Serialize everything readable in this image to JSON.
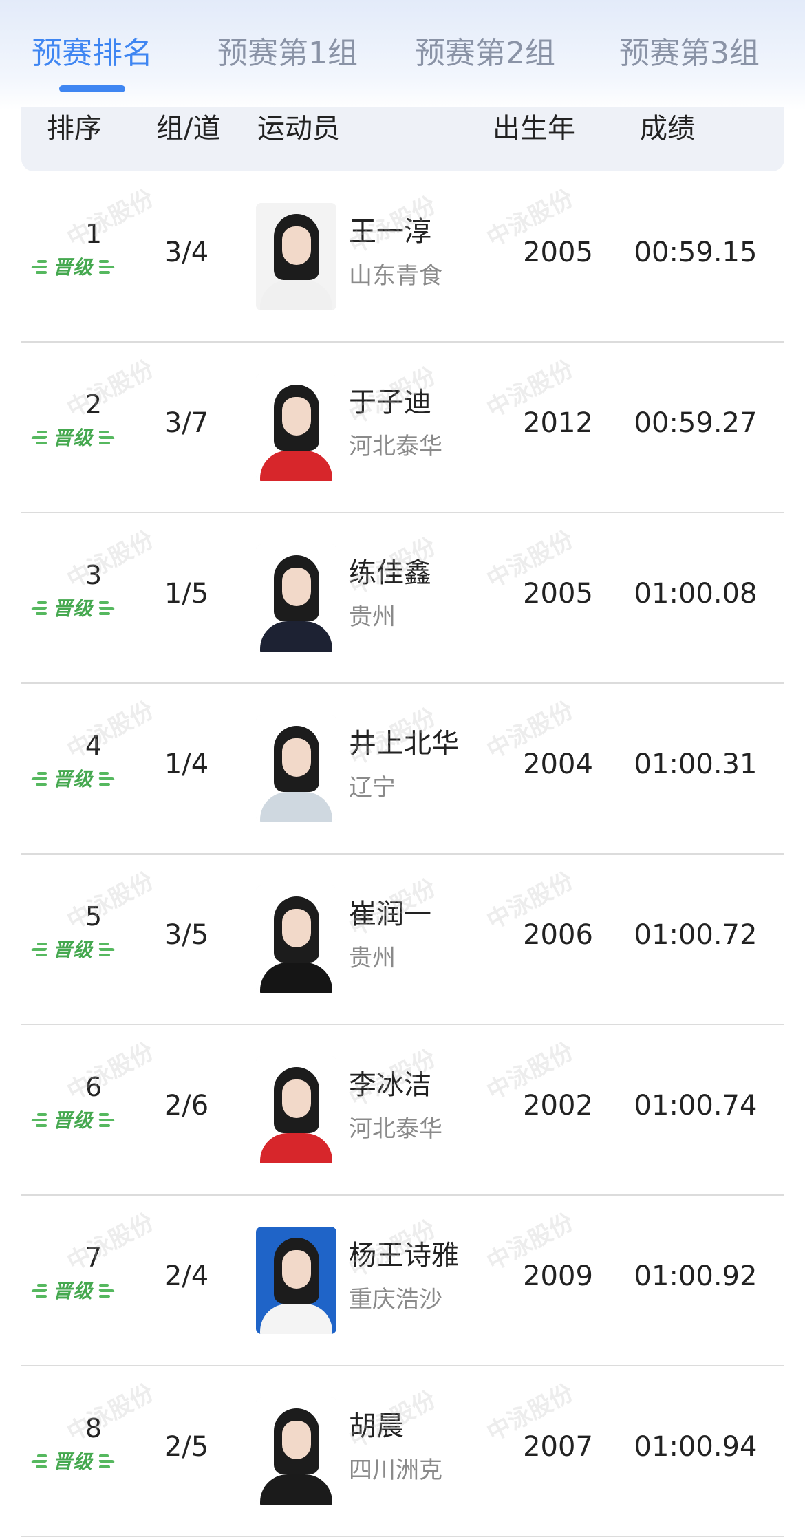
{
  "tabs": [
    {
      "label": "预赛排名",
      "active": true
    },
    {
      "label": "预赛第1组",
      "active": false
    },
    {
      "label": "预赛第2组",
      "active": false
    },
    {
      "label": "预赛第3组",
      "active": false
    }
  ],
  "table": {
    "headers": {
      "rank": "排序",
      "group_lane": "组/道",
      "athlete": "运动员",
      "birth_year": "出生年",
      "result": "成绩"
    },
    "badge_text": "晋级",
    "watermark_text": "中泳股份",
    "rows": [
      {
        "rank": "1",
        "group_lane": "3/4",
        "name": "王一淳",
        "team": "山东青食",
        "birth_year": "2005",
        "result": "00:59.15",
        "photo_bg": "#f3f3f3",
        "jersey": "#f0f0f0"
      },
      {
        "rank": "2",
        "group_lane": "3/7",
        "name": "于子迪",
        "team": "河北泰华",
        "birth_year": "2012",
        "result": "00:59.27",
        "photo_bg": "#ffffff",
        "jersey": "#d7262b"
      },
      {
        "rank": "3",
        "group_lane": "1/5",
        "name": "练佳鑫",
        "team": "贵州",
        "birth_year": "2005",
        "result": "01:00.08",
        "photo_bg": "#ffffff",
        "jersey": "#1d2233"
      },
      {
        "rank": "4",
        "group_lane": "1/4",
        "name": "井上北华",
        "team": "辽宁",
        "birth_year": "2004",
        "result": "01:00.31",
        "photo_bg": "#ffffff",
        "jersey": "#cfd8e0"
      },
      {
        "rank": "5",
        "group_lane": "3/5",
        "name": "崔润一",
        "team": "贵州",
        "birth_year": "2006",
        "result": "01:00.72",
        "photo_bg": "#ffffff",
        "jersey": "#151515"
      },
      {
        "rank": "6",
        "group_lane": "2/6",
        "name": "李冰洁",
        "team": "河北泰华",
        "birth_year": "2002",
        "result": "01:00.74",
        "photo_bg": "#ffffff",
        "jersey": "#d7262b"
      },
      {
        "rank": "7",
        "group_lane": "2/4",
        "name": "杨王诗雅",
        "team": "重庆浩沙",
        "birth_year": "2009",
        "result": "01:00.92",
        "photo_bg": "#1f64c8",
        "jersey": "#f4f4f4"
      },
      {
        "rank": "8",
        "group_lane": "2/5",
        "name": "胡晨",
        "team": "四川洲克",
        "birth_year": "2007",
        "result": "01:00.94",
        "photo_bg": "#ffffff",
        "jersey": "#1b1b1b"
      }
    ]
  },
  "colors": {
    "accent": "#3f86f2",
    "qualify_green": "#45a84f",
    "header_bg": "#eef1f7"
  }
}
